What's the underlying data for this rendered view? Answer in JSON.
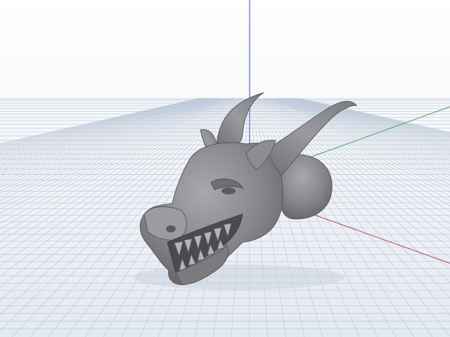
{
  "viewport": {
    "background_top": "#ffffff",
    "background_bottom": "#e3e9f2",
    "grid_color": "#b7c3d4",
    "axis_colors": {
      "x": "#b04a52",
      "y": "#4ea35a",
      "z": "#3a46c8"
    }
  },
  "model": {
    "kind": "dragon head sculpt",
    "color": "#8a8a8e"
  }
}
